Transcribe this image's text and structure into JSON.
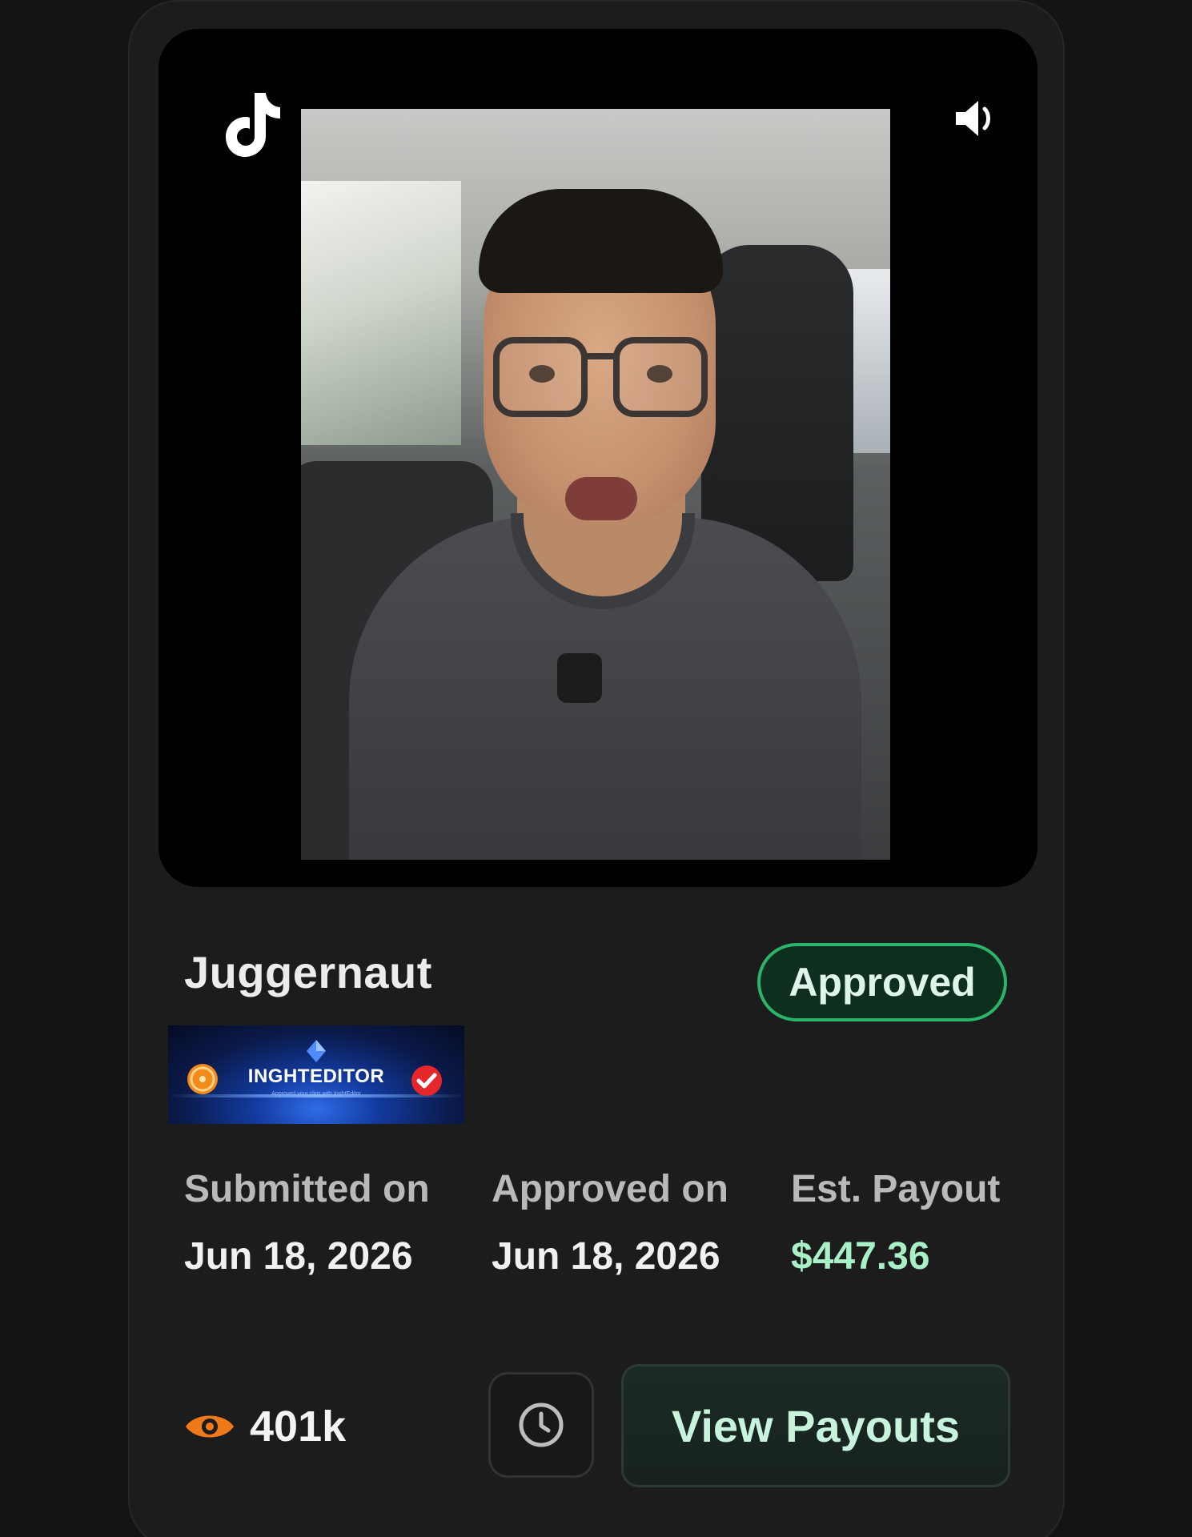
{
  "video": {
    "platform_icon": "tiktok-icon",
    "sound_icon": "speaker-volume-icon"
  },
  "campaign": {
    "title": "Juggernaut",
    "status": "Approved",
    "status_color": "#2bb56a"
  },
  "banner": {
    "brand": "INGHTEDITOR",
    "tagline": "Approved your clips with InghtEditor"
  },
  "meta": {
    "submitted_label": "Submitted on",
    "submitted_value": "Jun 18, 2026",
    "approved_label": "Approved on",
    "approved_value": "Jun 18, 2026",
    "payout_label": "Est. Payout",
    "payout_value": "$447.36",
    "payout_color": "#a8f0c6"
  },
  "footer": {
    "views_icon": "eye-icon",
    "views_count": "401k",
    "history_icon": "clock-icon",
    "payouts_button": "View Payouts"
  },
  "colors": {
    "background": "#141414",
    "card": "#1c1c1c",
    "accent_orange": "#f07a1a"
  }
}
